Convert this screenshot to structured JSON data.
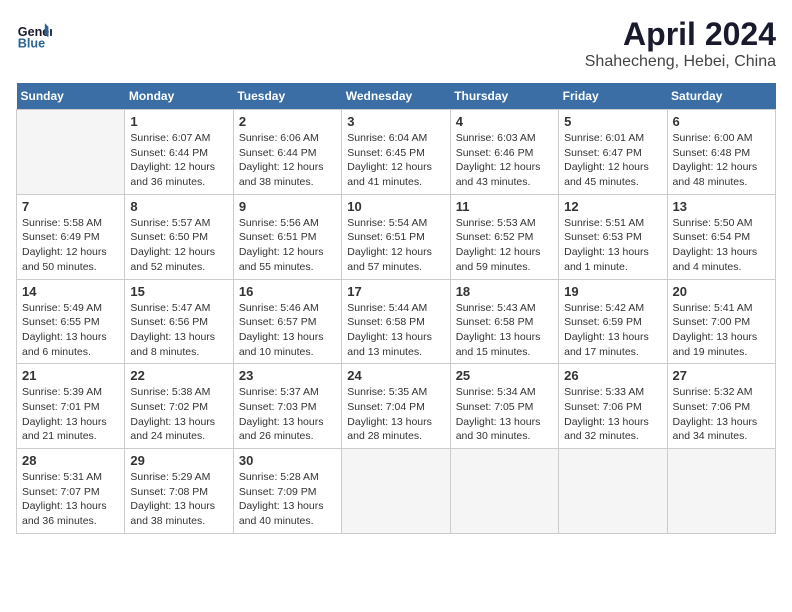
{
  "header": {
    "logo_line1": "General",
    "logo_line2": "Blue",
    "title": "April 2024",
    "location": "Shahecheng, Hebei, China"
  },
  "calendar": {
    "days_of_week": [
      "Sunday",
      "Monday",
      "Tuesday",
      "Wednesday",
      "Thursday",
      "Friday",
      "Saturday"
    ],
    "weeks": [
      [
        {
          "day": "",
          "info": ""
        },
        {
          "day": "1",
          "info": "Sunrise: 6:07 AM\nSunset: 6:44 PM\nDaylight: 12 hours\nand 36 minutes."
        },
        {
          "day": "2",
          "info": "Sunrise: 6:06 AM\nSunset: 6:44 PM\nDaylight: 12 hours\nand 38 minutes."
        },
        {
          "day": "3",
          "info": "Sunrise: 6:04 AM\nSunset: 6:45 PM\nDaylight: 12 hours\nand 41 minutes."
        },
        {
          "day": "4",
          "info": "Sunrise: 6:03 AM\nSunset: 6:46 PM\nDaylight: 12 hours\nand 43 minutes."
        },
        {
          "day": "5",
          "info": "Sunrise: 6:01 AM\nSunset: 6:47 PM\nDaylight: 12 hours\nand 45 minutes."
        },
        {
          "day": "6",
          "info": "Sunrise: 6:00 AM\nSunset: 6:48 PM\nDaylight: 12 hours\nand 48 minutes."
        }
      ],
      [
        {
          "day": "7",
          "info": "Sunrise: 5:58 AM\nSunset: 6:49 PM\nDaylight: 12 hours\nand 50 minutes."
        },
        {
          "day": "8",
          "info": "Sunrise: 5:57 AM\nSunset: 6:50 PM\nDaylight: 12 hours\nand 52 minutes."
        },
        {
          "day": "9",
          "info": "Sunrise: 5:56 AM\nSunset: 6:51 PM\nDaylight: 12 hours\nand 55 minutes."
        },
        {
          "day": "10",
          "info": "Sunrise: 5:54 AM\nSunset: 6:51 PM\nDaylight: 12 hours\nand 57 minutes."
        },
        {
          "day": "11",
          "info": "Sunrise: 5:53 AM\nSunset: 6:52 PM\nDaylight: 12 hours\nand 59 minutes."
        },
        {
          "day": "12",
          "info": "Sunrise: 5:51 AM\nSunset: 6:53 PM\nDaylight: 13 hours\nand 1 minute."
        },
        {
          "day": "13",
          "info": "Sunrise: 5:50 AM\nSunset: 6:54 PM\nDaylight: 13 hours\nand 4 minutes."
        }
      ],
      [
        {
          "day": "14",
          "info": "Sunrise: 5:49 AM\nSunset: 6:55 PM\nDaylight: 13 hours\nand 6 minutes."
        },
        {
          "day": "15",
          "info": "Sunrise: 5:47 AM\nSunset: 6:56 PM\nDaylight: 13 hours\nand 8 minutes."
        },
        {
          "day": "16",
          "info": "Sunrise: 5:46 AM\nSunset: 6:57 PM\nDaylight: 13 hours\nand 10 minutes."
        },
        {
          "day": "17",
          "info": "Sunrise: 5:44 AM\nSunset: 6:58 PM\nDaylight: 13 hours\nand 13 minutes."
        },
        {
          "day": "18",
          "info": "Sunrise: 5:43 AM\nSunset: 6:58 PM\nDaylight: 13 hours\nand 15 minutes."
        },
        {
          "day": "19",
          "info": "Sunrise: 5:42 AM\nSunset: 6:59 PM\nDaylight: 13 hours\nand 17 minutes."
        },
        {
          "day": "20",
          "info": "Sunrise: 5:41 AM\nSunset: 7:00 PM\nDaylight: 13 hours\nand 19 minutes."
        }
      ],
      [
        {
          "day": "21",
          "info": "Sunrise: 5:39 AM\nSunset: 7:01 PM\nDaylight: 13 hours\nand 21 minutes."
        },
        {
          "day": "22",
          "info": "Sunrise: 5:38 AM\nSunset: 7:02 PM\nDaylight: 13 hours\nand 24 minutes."
        },
        {
          "day": "23",
          "info": "Sunrise: 5:37 AM\nSunset: 7:03 PM\nDaylight: 13 hours\nand 26 minutes."
        },
        {
          "day": "24",
          "info": "Sunrise: 5:35 AM\nSunset: 7:04 PM\nDaylight: 13 hours\nand 28 minutes."
        },
        {
          "day": "25",
          "info": "Sunrise: 5:34 AM\nSunset: 7:05 PM\nDaylight: 13 hours\nand 30 minutes."
        },
        {
          "day": "26",
          "info": "Sunrise: 5:33 AM\nSunset: 7:06 PM\nDaylight: 13 hours\nand 32 minutes."
        },
        {
          "day": "27",
          "info": "Sunrise: 5:32 AM\nSunset: 7:06 PM\nDaylight: 13 hours\nand 34 minutes."
        }
      ],
      [
        {
          "day": "28",
          "info": "Sunrise: 5:31 AM\nSunset: 7:07 PM\nDaylight: 13 hours\nand 36 minutes."
        },
        {
          "day": "29",
          "info": "Sunrise: 5:29 AM\nSunset: 7:08 PM\nDaylight: 13 hours\nand 38 minutes."
        },
        {
          "day": "30",
          "info": "Sunrise: 5:28 AM\nSunset: 7:09 PM\nDaylight: 13 hours\nand 40 minutes."
        },
        {
          "day": "",
          "info": ""
        },
        {
          "day": "",
          "info": ""
        },
        {
          "day": "",
          "info": ""
        },
        {
          "day": "",
          "info": ""
        }
      ]
    ]
  }
}
